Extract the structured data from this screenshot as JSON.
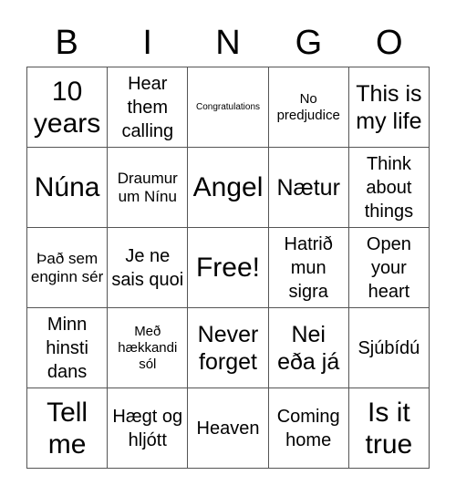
{
  "header": [
    "B",
    "I",
    "N",
    "G",
    "O"
  ],
  "cells": [
    {
      "text": "10 years",
      "size": "xl"
    },
    {
      "text": "Hear them calling",
      "size": "md"
    },
    {
      "text": "Congratulations",
      "size": "tiny"
    },
    {
      "text": "No predjudice",
      "size": "xs"
    },
    {
      "text": "This is my life",
      "size": "lg"
    },
    {
      "text": "Núna",
      "size": "xl"
    },
    {
      "text": "Draumur um Nínu",
      "size": "sm"
    },
    {
      "text": "Angel",
      "size": "xl"
    },
    {
      "text": "Nætur",
      "size": "lg"
    },
    {
      "text": "Think about things",
      "size": "md"
    },
    {
      "text": "Það sem enginn sér",
      "size": "sm"
    },
    {
      "text": "Je ne sais quoi",
      "size": "md"
    },
    {
      "text": "Free!",
      "size": "xl"
    },
    {
      "text": "Hatrið mun sigra",
      "size": "md"
    },
    {
      "text": "Open your heart",
      "size": "md"
    },
    {
      "text": "Minn hinsti dans",
      "size": "md"
    },
    {
      "text": "Með hækkandi sól",
      "size": "xs"
    },
    {
      "text": "Never forget",
      "size": "lg"
    },
    {
      "text": "Nei eða já",
      "size": "lg"
    },
    {
      "text": "Sjúbídú",
      "size": "md"
    },
    {
      "text": "Tell me",
      "size": "xl"
    },
    {
      "text": "Hægt og hljótt",
      "size": "md"
    },
    {
      "text": "Heaven",
      "size": "md"
    },
    {
      "text": "Coming home",
      "size": "md"
    },
    {
      "text": "Is it true",
      "size": "xl"
    }
  ]
}
